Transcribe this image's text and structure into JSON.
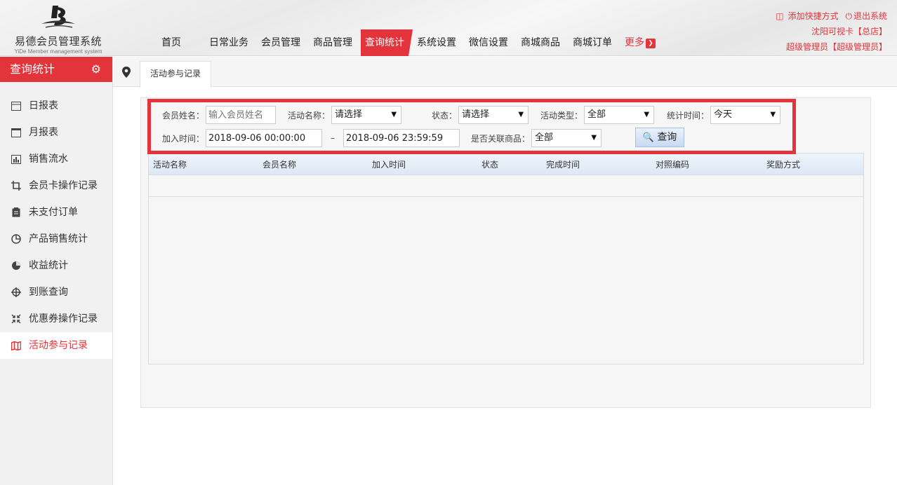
{
  "header": {
    "logo_title": "易德会员管理系统",
    "logo_sub": "YiDe Member management system",
    "add_shortcut": "添加快捷方式",
    "logout": "退出系统",
    "store": "沈阳可视卡【总店】",
    "admin": "超级管理员【超级管理员】"
  },
  "nav": {
    "items": [
      "首页",
      "日常业务",
      "会员管理",
      "商品管理",
      "查询统计",
      "系统设置",
      "微信设置",
      "商城商品",
      "商城订单"
    ],
    "more": "更多",
    "active_index": 4
  },
  "sidebar": {
    "title": "查询统计",
    "items": [
      {
        "label": "日报表",
        "icon": "calendar-icon"
      },
      {
        "label": "月报表",
        "icon": "calendar-month-icon"
      },
      {
        "label": "销售流水",
        "icon": "bar-chart-icon"
      },
      {
        "label": "会员卡操作记录",
        "icon": "crop-icon"
      },
      {
        "label": "未支付订单",
        "icon": "clipboard-icon"
      },
      {
        "label": "产品销售统计",
        "icon": "pie-outline-icon"
      },
      {
        "label": "收益统计",
        "icon": "pie-fill-icon"
      },
      {
        "label": "到账查询",
        "icon": "crosshair-icon"
      },
      {
        "label": "优惠券操作记录",
        "icon": "collapse-icon"
      },
      {
        "label": "活动参与记录",
        "icon": "map-icon"
      }
    ],
    "active_index": 9
  },
  "tab": {
    "label": "活动参与记录"
  },
  "filters": {
    "member_name_label": "会员姓名：",
    "member_name_placeholder": "输入会员姓名",
    "activity_name_label": "活动名称：",
    "activity_name_value": "请选择",
    "status_label": "状态：",
    "status_value": "请选择",
    "activity_type_label": "活动类型：",
    "activity_type_value": "全部",
    "stat_time_label": "统计时间：",
    "stat_time_value": "今天",
    "join_time_label": "加入时间：",
    "join_time_start": "2018-09-06 00:00:00",
    "join_time_sep": "–",
    "join_time_end": "2018-09-06 23:59:59",
    "linked_product_label": "是否关联商品：",
    "linked_product_value": "全部",
    "query_button": "查询"
  },
  "table": {
    "columns": [
      "活动名称",
      "会员名称",
      "加入时间",
      "状态",
      "完成时间",
      "对照编码",
      "奖励方式"
    ]
  },
  "colors": {
    "accent": "#e2343a",
    "header_row": "#dde8f6"
  }
}
